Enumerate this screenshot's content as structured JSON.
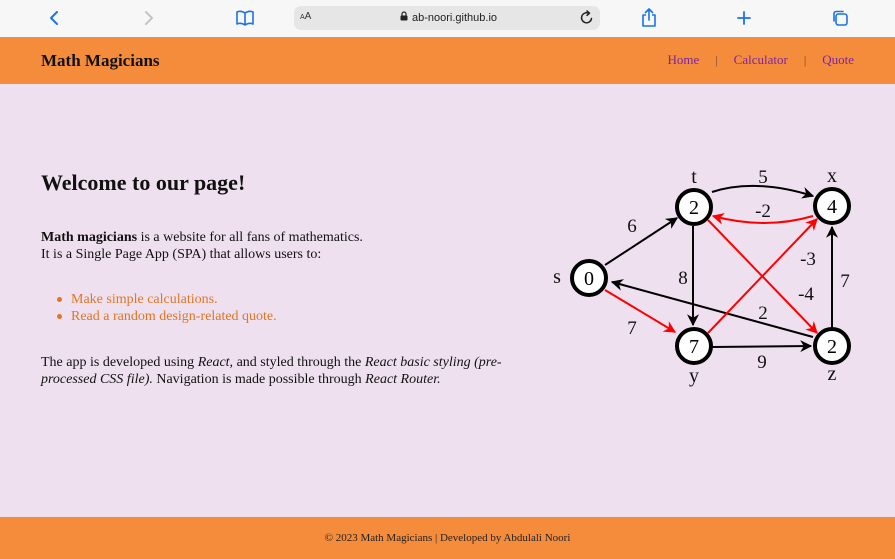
{
  "browser": {
    "aa_small": "A",
    "aa_large": "A",
    "url": "ab-noori.github.io",
    "icons": [
      "back-icon",
      "forward-icon",
      "bookmarks-icon",
      "lock-icon",
      "reload-icon",
      "share-icon",
      "plus-icon",
      "tabs-icon"
    ]
  },
  "header": {
    "brand": "Math Magicians",
    "nav": {
      "home": "Home",
      "calculator": "Calculator",
      "quote": "Quote",
      "separator": "|"
    }
  },
  "main": {
    "title": "Welcome to our page!",
    "intro_bold": "Math magicians",
    "intro_rest": " is a website for all fans of mathematics.",
    "intro_line2": "It is a Single Page App (SPA) that allows users to:",
    "features": [
      "Make simple calculations.",
      "Read a random design-related quote."
    ],
    "tech": {
      "t1": "The app is developed using ",
      "react": "React,",
      "t2": " and styled through the ",
      "styling": "React basic styling (pre-processed CSS file).",
      "t3": " Navigation is made possible through ",
      "router": "React Router."
    }
  },
  "graph": {
    "nodes": {
      "s": {
        "name": "s",
        "value": "0"
      },
      "t": {
        "name": "t",
        "value": "2"
      },
      "x": {
        "name": "x",
        "value": "4"
      },
      "y": {
        "name": "y",
        "value": "7"
      },
      "z": {
        "name": "z",
        "value": "2"
      }
    },
    "weights": {
      "s_t": "6",
      "t_x": "5",
      "x_t": "-2",
      "s_y": "7",
      "t_y": "8",
      "y_z": "9",
      "z_s": "2",
      "y_x": "-3",
      "t_z": "-4",
      "z_x": "7"
    },
    "colors": {
      "black_edge": "#000000",
      "red_edge": "#ff0000"
    }
  },
  "footer": {
    "text": "© 2023 Math Magicians | Developed by Abdulali Noori"
  },
  "colors": {
    "header_bg": "#f48c3c",
    "page_bg": "#efe0ef",
    "nav_link": "#7c24a8",
    "feature_text": "#e07623"
  }
}
